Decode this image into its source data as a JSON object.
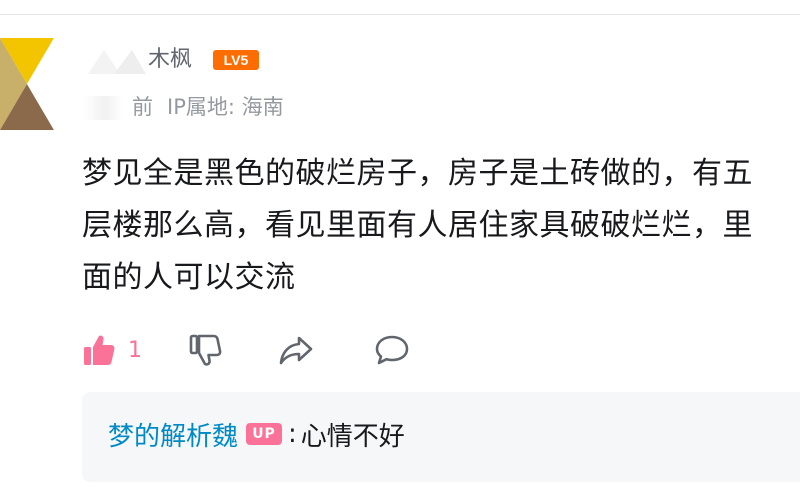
{
  "comment": {
    "author": {
      "name_visible": "木枫",
      "level": "LV5"
    },
    "meta": {
      "time_visible": "前",
      "ip_location": "IP属地: 海南"
    },
    "body_lines": [
      "梦见全是黑色的破烂房子，房子是土砖做的，有五",
      "层楼那么高，看见里面有人居住家具破破烂烂，里",
      "面的人可以交流"
    ],
    "actions": {
      "like_count": "1",
      "like_icon": "thumbs-up-icon",
      "dislike_icon": "thumbs-down-icon",
      "share_icon": "share-icon",
      "reply_icon": "comment-bubble-icon"
    },
    "colors": {
      "like_active": "#fb7299",
      "link_blue": "#008ac5",
      "level_orange": "#ff6c00",
      "reply_bg": "#f6f7f8"
    }
  },
  "reply": {
    "author": "梦的解析魏",
    "badge": "UP",
    "separator": ":",
    "text": "心情不好"
  }
}
